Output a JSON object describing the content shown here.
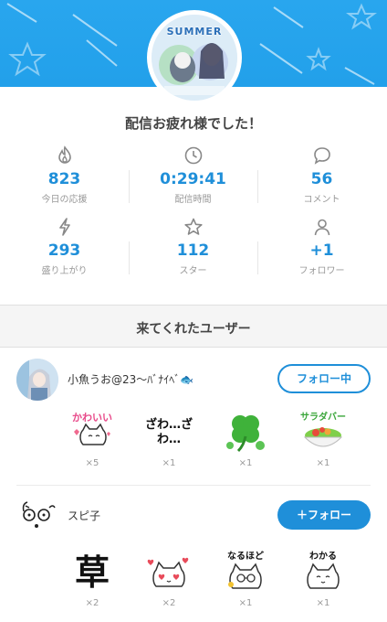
{
  "header": {
    "avatar_badge": "SUMMER",
    "headline": "配信お疲れ様でした！"
  },
  "stats": [
    {
      "icon": "flame-icon",
      "value": "823",
      "label": "今日の応援"
    },
    {
      "icon": "clock-icon",
      "value": "0:29:41",
      "label": "配信時間"
    },
    {
      "icon": "speech-bubble-icon",
      "value": "56",
      "label": "コメント"
    },
    {
      "icon": "lightning-icon",
      "value": "293",
      "label": "盛り上がり"
    },
    {
      "icon": "star-icon",
      "value": "112",
      "label": "スター"
    },
    {
      "icon": "person-icon",
      "value": "+1",
      "label": "フォロワー"
    }
  ],
  "section": {
    "title": "来てくれたユーザー"
  },
  "users": [
    {
      "name": "小魚うお@23～ﾊﾞﾅｲﾍﾞ🐟",
      "button": "フォロー中",
      "stamps": [
        {
          "name": "kawaii-cat-stamp",
          "text": "かわいい",
          "count": "×5"
        },
        {
          "name": "zawa-stamp",
          "text": "ざわ…ざわ…",
          "count": "×1"
        },
        {
          "name": "clover-stamp",
          "text": "",
          "count": "×1"
        },
        {
          "name": "salad-bar-stamp",
          "text": "サラダバー",
          "count": "×1"
        }
      ]
    },
    {
      "name": "スピ子",
      "button": "＋フォロー",
      "stamps": [
        {
          "name": "kusa-stamp",
          "text": "草",
          "count": "×2"
        },
        {
          "name": "heart-cat-stamp",
          "text": "",
          "count": "×2"
        },
        {
          "name": "naruhodo-cat-stamp",
          "text": "なるほど",
          "count": "×1"
        },
        {
          "name": "wakaru-cat-stamp",
          "text": "わかる",
          "count": "×1"
        }
      ]
    }
  ],
  "colors": {
    "accent": "#1f8fd9",
    "banner": "#29a6ee"
  }
}
